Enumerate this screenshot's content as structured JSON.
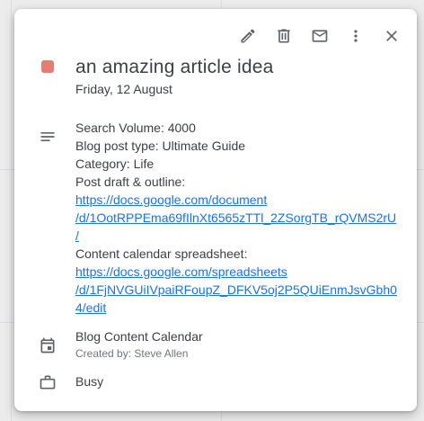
{
  "toolbar": {
    "edit_icon": "pencil-icon",
    "delete_icon": "trash-icon",
    "email_icon": "mail-icon",
    "more_icon": "more-vert-icon",
    "close_icon": "close-icon"
  },
  "event": {
    "color": "#e67c73",
    "title": "an amazing article idea",
    "date": "Friday, 12 August"
  },
  "description": {
    "lines": [
      "Search Volume: 4000",
      "Blog post type: Ultimate Guide",
      "Category: Life",
      "Post draft & outline:"
    ],
    "draft_link": [
      "https://docs.google.com/document",
      "/d/1OotRPPEma69fIlnXt6565zTTl_2ZSorgTB_rQVMS2rU",
      "/"
    ],
    "spreadsheet_label": "Content calendar spreadsheet:",
    "spreadsheet_link": [
      "https://docs.google.com/spreadsheets",
      "/d/1FjNVGUiIVpaiRFoupZ_DFKV5oj2P5QUiEnmJsvGbh0",
      "4/edit"
    ]
  },
  "calendar": {
    "name": "Blog Content Calendar",
    "created_by": "Created by: Steve Allen"
  },
  "availability": {
    "status": "Busy"
  },
  "colors": {
    "link": "#1a73e8",
    "text": "#3c4043",
    "icon": "#5f6368"
  }
}
